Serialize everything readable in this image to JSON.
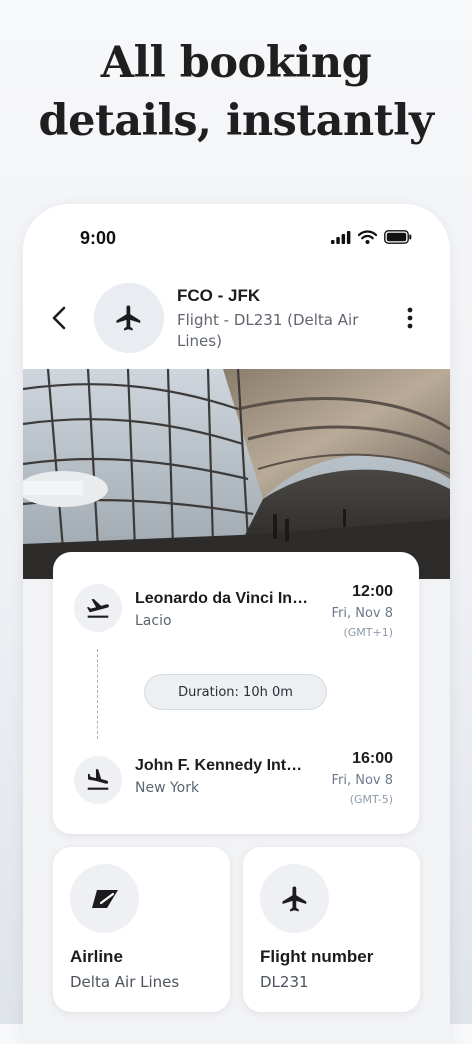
{
  "headline": {
    "line1": "All booking",
    "line2": "details, instantly"
  },
  "status_bar": {
    "time": "9:00",
    "icons": [
      "cellular-signal-icon",
      "wifi-icon",
      "battery-icon"
    ]
  },
  "header": {
    "back_icon": "chevron-left-icon",
    "avatar_icon": "airplane-icon",
    "title": "FCO - JFK",
    "subtitle": "Flight - DL231 (Delta Air Lines)",
    "menu_icon": "more-vertical-icon"
  },
  "hero_image": "airport-terminal-photo",
  "flight": {
    "departure": {
      "icon": "takeoff-icon",
      "airport": "Leonardo da Vinci International Airport",
      "city": "Lacio",
      "time": "12:00",
      "date": "Fri, Nov 8",
      "timezone": "(GMT+1)"
    },
    "duration": "Duration: 10h 0m",
    "arrival": {
      "icon": "landing-icon",
      "airport": "John F. Kennedy International Airport",
      "city": "New York",
      "time": "16:00",
      "date": "Fri, Nov 8",
      "timezone": "(GMT-5)"
    }
  },
  "details": [
    {
      "icon": "airline-logo-icon",
      "label": "Airline",
      "value": "Delta Air Lines"
    },
    {
      "icon": "airplane-icon",
      "label": "Flight number",
      "value": "DL231"
    }
  ],
  "colors": {
    "background": "#eef0f4",
    "card": "#ffffff",
    "icon_circle": "#eef0f3",
    "text_primary": "#1c1c1e",
    "text_secondary": "#5b6470"
  }
}
